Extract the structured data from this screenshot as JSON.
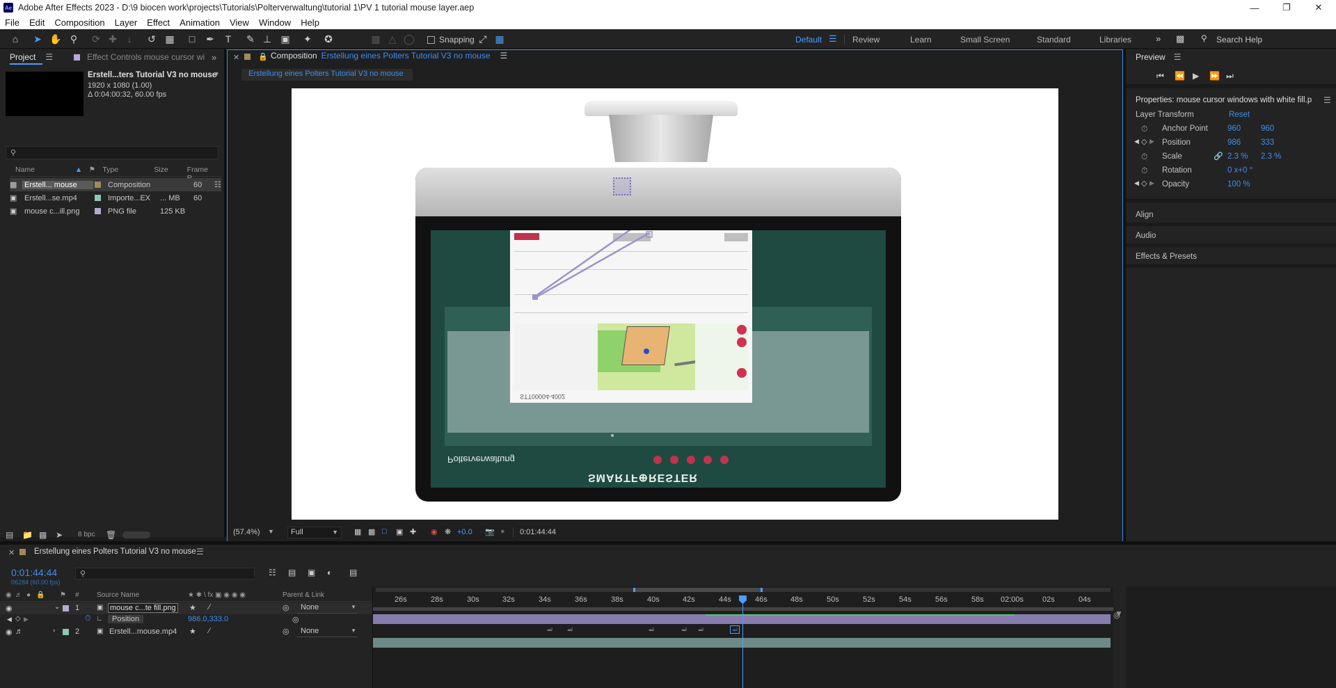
{
  "window": {
    "title": "Adobe After Effects 2023 - D:\\9 biocen work\\projects\\Tutorials\\Polterverwaltung\\tutorial 1\\PV 1 tutorial mouse layer.aep",
    "logo": "Ae"
  },
  "menu": [
    "File",
    "Edit",
    "Composition",
    "Layer",
    "Effect",
    "Animation",
    "View",
    "Window",
    "Help"
  ],
  "toolbar": {
    "snapping_label": "Snapping",
    "search_placeholder": "Search Help"
  },
  "workspaces": [
    "Default",
    "Review",
    "Learn",
    "Small Screen",
    "Standard",
    "Libraries"
  ],
  "project_panel": {
    "tab_project": "Project",
    "tab_effect_controls": "Effect Controls  mouse cursor wi",
    "selected_name": "Erstell...ters Tutorial V3 no mouse",
    "selected_res": "1920 x 1080 (1.00)",
    "selected_dur": "Δ 0:04:00:32, 60.00 fps",
    "columns": [
      "Name",
      "Type",
      "Size",
      "Frame R..."
    ],
    "items": [
      {
        "name": "Erstell... mouse",
        "type": "Composition",
        "size": "",
        "fps": "60",
        "color": "#a08a5b"
      },
      {
        "name": "Erstell...se.mp4",
        "type": "Importe...EX",
        "size": "... MB",
        "fps": "60",
        "color": "#8dc6b8"
      },
      {
        "name": "mouse c...ill.png",
        "type": "PNG file",
        "size": "125 KB",
        "fps": "",
        "color": "#b9a8d6"
      }
    ],
    "bpc": "8 bpc"
  },
  "comp_panel": {
    "tab_prefix": "Composition",
    "tab_name": "Erstellung eines Polters Tutorial V3 no mouse",
    "breadcrumb": "Erstellung eines Polters Tutorial V3 no mouse",
    "zoom": "(57.4%)",
    "quality": "Full",
    "exposure": "+0.0",
    "timecode": "0:01:44:44"
  },
  "monitor": {
    "brand_text": "SMARTF⊕RESTER",
    "app_title": "Polterverwaltung",
    "doc_id": "STT00004-4002"
  },
  "preview_panel": {
    "title": "Preview"
  },
  "properties_panel": {
    "title": "Properties: mouse cursor windows with white fill.p",
    "section": "Layer Transform",
    "reset": "Reset",
    "rows": [
      {
        "label": "Anchor Point",
        "v1": "960",
        "v2": "960"
      },
      {
        "label": "Position",
        "v1": "986",
        "v2": "333"
      },
      {
        "label": "Scale",
        "v1": "2.3 %",
        "v2": "2.3 %"
      },
      {
        "label": "Rotation",
        "v1": "0 x+0 °",
        "v2": ""
      },
      {
        "label": "Opacity",
        "v1": "100 %",
        "v2": ""
      }
    ],
    "collapsed": [
      "Align",
      "Audio",
      "Effects & Presets"
    ]
  },
  "timeline": {
    "tab_name": "Erstellung eines Polters Tutorial V3 no mouse",
    "current_time": "0:01:44:44",
    "frame_info": "06284 (60.00 fps)",
    "col_source": "Source Name",
    "col_parent": "Parent & Link",
    "layers": [
      {
        "num": "1",
        "name": "mouse c...te fill.png",
        "parent": "None",
        "color": "#b9a8d6"
      },
      {
        "num": "2",
        "name": "Erstell...mouse.mp4",
        "parent": "None",
        "color": "#8dc6b8"
      }
    ],
    "position_label": "Position",
    "position_value": "986.0,333.0",
    "ruler": [
      "26s",
      "28s",
      "30s",
      "32s",
      "34s",
      "36s",
      "38s",
      "40s",
      "42s",
      "44s",
      "46s",
      "48s",
      "50s",
      "52s",
      "54s",
      "56s",
      "58s",
      "02:00s",
      "02s",
      "04s"
    ],
    "playhead_fraction": 0.499
  }
}
